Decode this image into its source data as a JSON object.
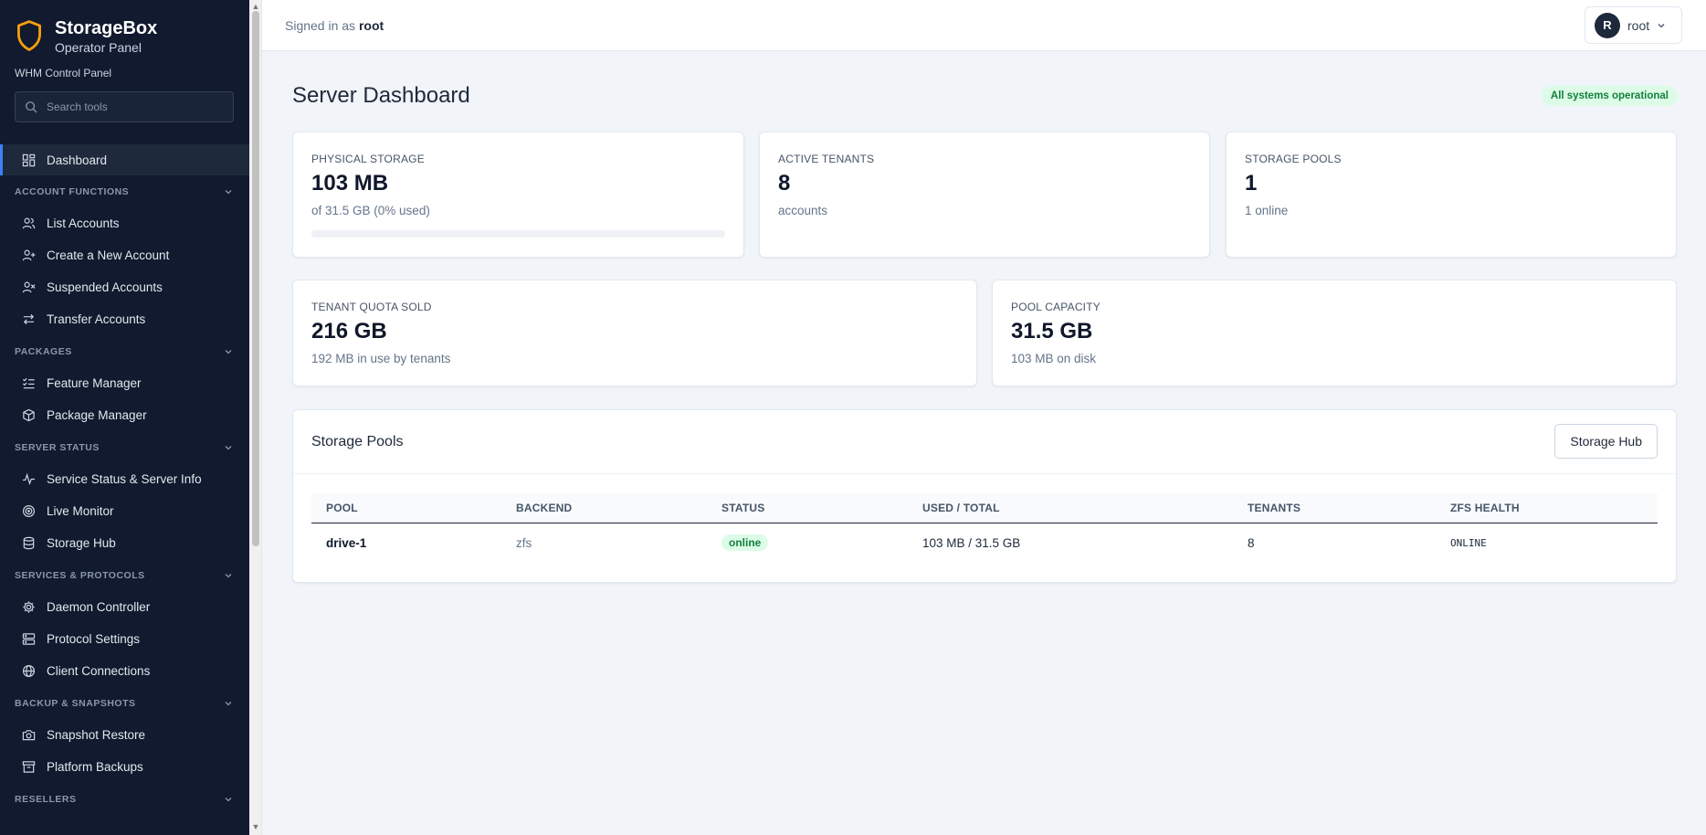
{
  "brand": {
    "name": "StorageBox",
    "subtitle": "Operator Panel",
    "tagline": "WHM Control Panel"
  },
  "search": {
    "placeholder": "Search tools"
  },
  "nav": {
    "dashboard": "Dashboard",
    "sections": {
      "account_functions": "ACCOUNT FUNCTIONS",
      "packages": "PACKAGES",
      "server_status": "SERVER STATUS",
      "services_protocols": "SERVICES & PROTOCOLS",
      "backup_snapshots": "BACKUP & SNAPSHOTS",
      "resellers": "RESELLERS"
    },
    "items": {
      "list_accounts": "List Accounts",
      "create_account": "Create a New Account",
      "suspended_accounts": "Suspended Accounts",
      "transfer_accounts": "Transfer Accounts",
      "feature_manager": "Feature Manager",
      "package_manager": "Package Manager",
      "service_status": "Service Status & Server Info",
      "live_monitor": "Live Monitor",
      "storage_hub": "Storage Hub",
      "daemon_controller": "Daemon Controller",
      "protocol_settings": "Protocol Settings",
      "client_connections": "Client Connections",
      "snapshot_restore": "Snapshot Restore",
      "platform_backups": "Platform Backups"
    }
  },
  "topbar": {
    "signed_in_prefix": "Signed in as",
    "username": "root",
    "avatar_initial": "R"
  },
  "page": {
    "title": "Server Dashboard",
    "status_badge": "All systems operational"
  },
  "cards": {
    "physical_storage": {
      "label": "PHYSICAL STORAGE",
      "value": "103 MB",
      "sub": "of 31.5 GB (0% used)",
      "progress_percent": 0
    },
    "active_tenants": {
      "label": "ACTIVE TENANTS",
      "value": "8",
      "sub": "accounts"
    },
    "storage_pools": {
      "label": "STORAGE POOLS",
      "value": "1",
      "sub": "1 online"
    },
    "tenant_quota": {
      "label": "TENANT QUOTA SOLD",
      "value": "216 GB",
      "sub": "192 MB in use by tenants"
    },
    "pool_capacity": {
      "label": "POOL CAPACITY",
      "value": "31.5 GB",
      "sub": "103 MB on disk"
    }
  },
  "pools": {
    "title": "Storage Pools",
    "hub_button": "Storage Hub",
    "columns": {
      "pool": "POOL",
      "backend": "BACKEND",
      "status": "STATUS",
      "used_total": "USED / TOTAL",
      "tenants": "TENANTS",
      "zfs_health": "ZFS HEALTH"
    },
    "rows": [
      {
        "pool": "drive-1",
        "backend": "zfs",
        "status": "online",
        "used_total": "103 MB / 31.5 GB",
        "tenants": "8",
        "zfs_health": "ONLINE"
      }
    ]
  },
  "colors": {
    "sidebar_bg": "#111a2e",
    "accent": "#3b82f6",
    "brand_orange": "#f59e0b",
    "success_bg": "#dcfce7",
    "success_text": "#15803d"
  }
}
